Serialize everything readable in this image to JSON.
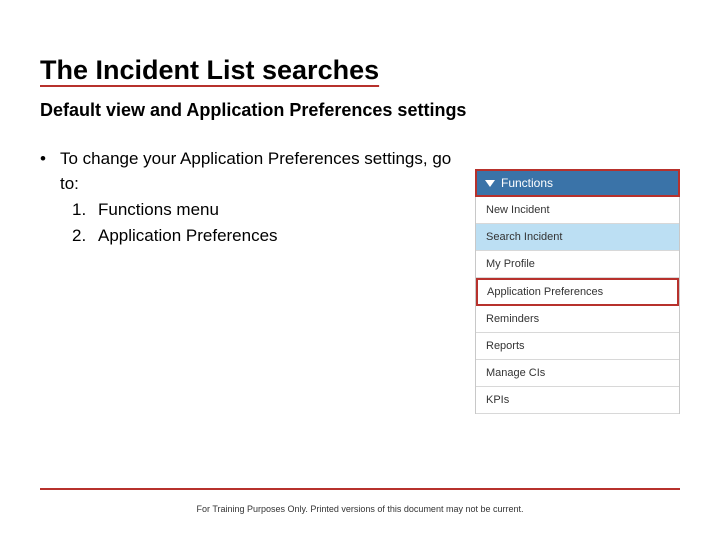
{
  "title": "The Incident List searches",
  "subtitle": "Default view and Application Preferences settings",
  "bullet_lead": "To change your Application Preferences settings, go to:",
  "steps": [
    {
      "num": "1.",
      "label": "Functions menu"
    },
    {
      "num": "2.",
      "label": "Application Preferences"
    }
  ],
  "menu": {
    "header": "Functions",
    "items": [
      {
        "label": "New Incident",
        "selected": false,
        "highlight": false
      },
      {
        "label": "Search Incident",
        "selected": true,
        "highlight": false
      },
      {
        "label": "My Profile",
        "selected": false,
        "highlight": false
      },
      {
        "label": "Application Preferences",
        "selected": false,
        "highlight": true
      },
      {
        "label": "Reminders",
        "selected": false,
        "highlight": false
      },
      {
        "label": "Reports",
        "selected": false,
        "highlight": false
      },
      {
        "label": "Manage CIs",
        "selected": false,
        "highlight": false
      },
      {
        "label": "KPIs",
        "selected": false,
        "highlight": false
      }
    ]
  },
  "footer": "For Training Purposes Only. Printed versions of this document may not be current."
}
